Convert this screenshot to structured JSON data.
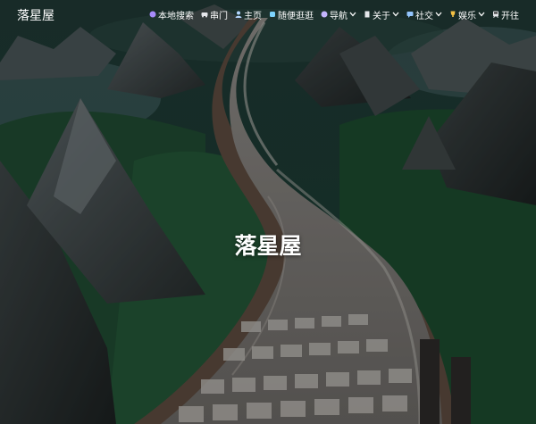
{
  "site": {
    "brand": "落星屋",
    "hero_title": "落星屋"
  },
  "nav": {
    "items": [
      {
        "label": "本地搜索",
        "icon": "search-icon",
        "dropdown": false
      },
      {
        "label": "串门",
        "icon": "car-icon",
        "dropdown": false
      },
      {
        "label": "主页",
        "icon": "user-icon",
        "dropdown": false
      },
      {
        "label": "随便逛逛",
        "icon": "link-icon",
        "dropdown": false
      },
      {
        "label": "导航",
        "icon": "globe-icon",
        "dropdown": true
      },
      {
        "label": "关于",
        "icon": "file-icon",
        "dropdown": true
      },
      {
        "label": "社交",
        "icon": "chat-icon",
        "dropdown": true
      },
      {
        "label": "娱乐",
        "icon": "trophy-icon",
        "dropdown": true
      },
      {
        "label": "开往",
        "icon": "train-icon",
        "dropdown": false
      }
    ]
  },
  "colors": {
    "nav_text": "#ffffff",
    "search_icon": "#a78bfa",
    "user_icon": "#b4d6ff",
    "link_icon": "#7dd3fc",
    "globe_icon": "#c4b5fd",
    "trophy_icon": "#f6c244"
  }
}
